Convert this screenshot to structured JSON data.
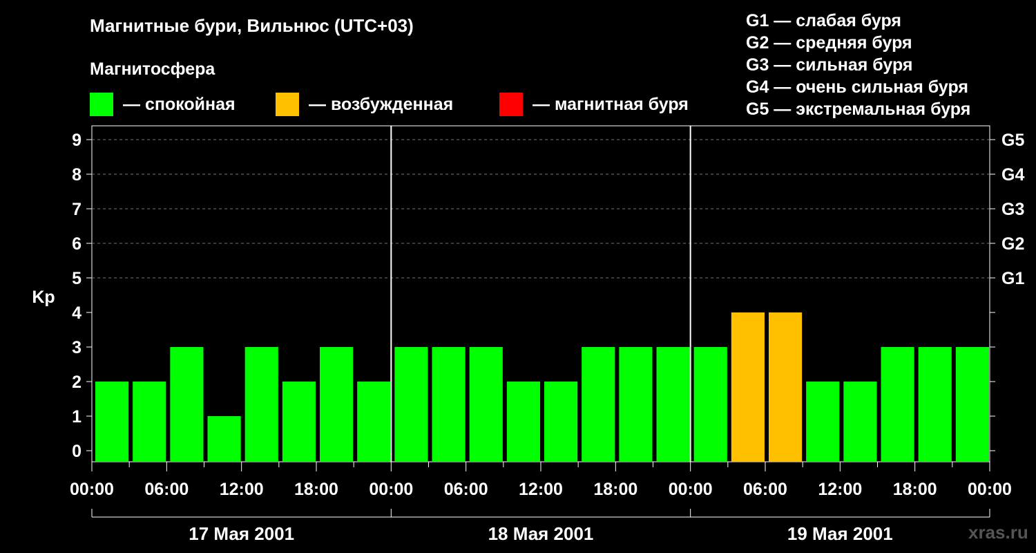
{
  "header": {
    "title": "Магнитные бури, Вильнюс (UTC+03)",
    "subtitle": "Магнитосфера"
  },
  "legend": [
    {
      "label": "— спокойная",
      "color": "#00ff00"
    },
    {
      "label": "— возбужденная",
      "color": "#ffc000"
    },
    {
      "label": "— магнитная буря",
      "color": "#ff0000"
    }
  ],
  "g_scale": [
    "G1 — слабая буря",
    "G2 — средняя буря",
    "G3 — сильная буря",
    "G4 — очень сильная буря",
    "G5 — экстремальная буря"
  ],
  "watermark": "xras.ru",
  "chart_data": {
    "type": "bar",
    "ylabel": "Kp",
    "ylim": [
      0,
      9
    ],
    "y_ticks": [
      "0",
      "1",
      "2",
      "3",
      "4",
      "5",
      "6",
      "7",
      "8",
      "9"
    ],
    "right_ticks": [
      {
        "value": 5,
        "label": "G1"
      },
      {
        "value": 6,
        "label": "G2"
      },
      {
        "value": 7,
        "label": "G3"
      },
      {
        "value": 8,
        "label": "G4"
      },
      {
        "value": 9,
        "label": "G5"
      }
    ],
    "grid": "dashed horizontal at 5–9",
    "x_tick_labels": [
      "00:00",
      "06:00",
      "12:00",
      "18:00",
      "00:00",
      "06:00",
      "12:00",
      "18:00",
      "00:00",
      "06:00",
      "12:00",
      "18:00",
      "00:00"
    ],
    "days": [
      "17 Мая 2001",
      "18 Мая 2001",
      "19 Мая 2001"
    ],
    "bars_per_day": 8,
    "values": [
      2,
      2,
      3,
      1,
      3,
      2,
      3,
      2,
      3,
      3,
      3,
      2,
      2,
      3,
      3,
      3,
      3,
      4,
      4,
      2,
      2,
      3,
      3,
      3
    ],
    "colors": {
      "quiet": "#00ff00",
      "active": "#ffc000",
      "storm": "#ff0000"
    }
  }
}
